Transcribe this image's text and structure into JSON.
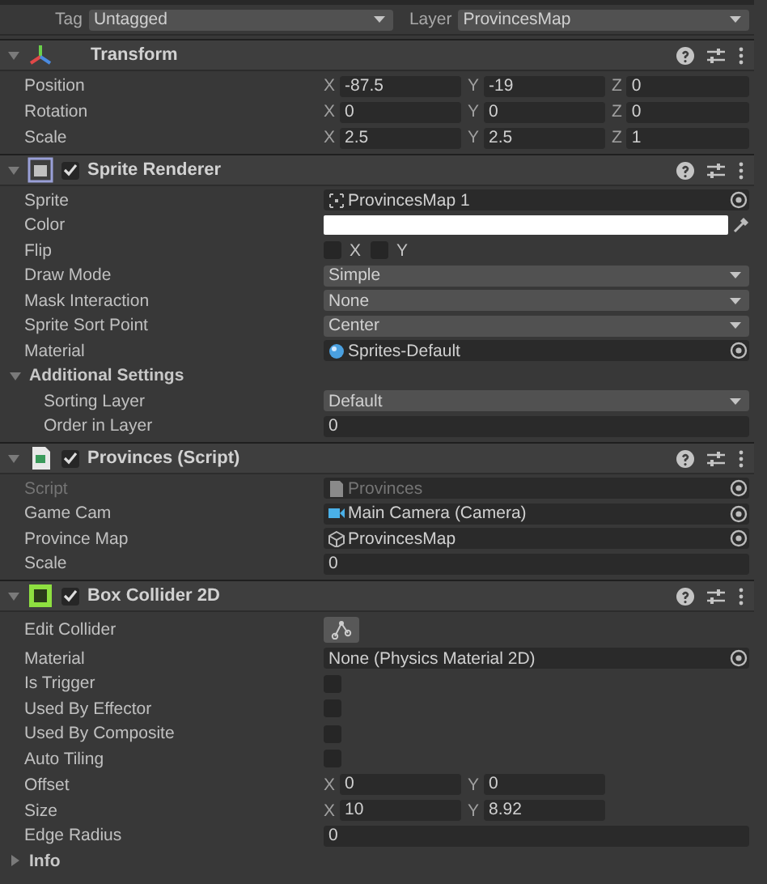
{
  "header": {
    "tag_label": "Tag",
    "tag": "Untagged",
    "layer_label": "Layer",
    "layer": "ProvincesMap"
  },
  "components": [
    {
      "name": "Transform",
      "kind": "transform",
      "expanded": true,
      "rows": [
        {
          "kind": "vector",
          "label": "Position",
          "axes": [
            {
              "axis": "X",
              "value": "-87.5"
            },
            {
              "axis": "Y",
              "value": "-19"
            },
            {
              "axis": "Z",
              "value": "0"
            }
          ]
        },
        {
          "kind": "vector",
          "label": "Rotation",
          "axes": [
            {
              "axis": "X",
              "value": "0"
            },
            {
              "axis": "Y",
              "value": "0"
            },
            {
              "axis": "Z",
              "value": "0"
            }
          ]
        },
        {
          "kind": "vector",
          "label": "Scale",
          "axes": [
            {
              "axis": "X",
              "value": "2.5"
            },
            {
              "axis": "Y",
              "value": "2.5"
            },
            {
              "axis": "Z",
              "value": "1"
            }
          ]
        }
      ]
    },
    {
      "name": "Sprite Renderer",
      "kind": "renderer",
      "enabled": true,
      "expanded": true,
      "rows": [
        {
          "kind": "sprite",
          "label": "Sprite",
          "value": "ProvincesMap 1",
          "disabled": false
        },
        {
          "kind": "color",
          "label": "Color",
          "color": "#ffffff"
        },
        {
          "kind": "flip",
          "label": "Flip",
          "toggles": [
            {
              "label": "X",
              "checked": false
            },
            {
              "label": "Y",
              "checked": false
            }
          ]
        },
        {
          "kind": "dropdown",
          "label": "Draw Mode",
          "value": "Simple"
        },
        {
          "kind": "dropdown",
          "label": "Mask Interaction",
          "value": "None"
        },
        {
          "kind": "dropdown",
          "label": "Sprite Sort Point",
          "value": "Center"
        },
        {
          "kind": "material",
          "label": "Material",
          "value": "Sprites-Default",
          "disabled": false
        },
        {
          "kind": "foldout",
          "label": "Additional Settings",
          "expanded": true,
          "children": [
            {
              "kind": "dropdown",
              "label": "Sorting Layer",
              "value": "Default"
            },
            {
              "kind": "field",
              "label": "Order in Layer",
              "value": "0"
            }
          ]
        }
      ]
    },
    {
      "name": "Provinces (Script)",
      "kind": "script",
      "enabled": true,
      "expanded": true,
      "rows": [
        {
          "kind": "script",
          "label": "Script",
          "value": "Provinces",
          "disabled": true
        },
        {
          "kind": "camera",
          "label": "Game Cam",
          "value": "Main Camera (Camera)",
          "disabled": false
        },
        {
          "kind": "prefab",
          "label": "Province Map",
          "value": "ProvincesMap",
          "disabled": false
        },
        {
          "kind": "field",
          "label": "Scale",
          "value": "0"
        }
      ]
    },
    {
      "name": "Box Collider 2D",
      "kind": "collider",
      "enabled": true,
      "expanded": true,
      "rows": [
        {
          "kind": "button",
          "label": "Edit Collider"
        },
        {
          "kind": "reference",
          "label": "Material",
          "value": "None (Physics Material 2D)",
          "disabled": false
        },
        {
          "kind": "checkbox",
          "label": "Is Trigger",
          "checked": false
        },
        {
          "kind": "checkbox",
          "label": "Used By Effector",
          "checked": false
        },
        {
          "kind": "checkbox",
          "label": "Used By Composite",
          "checked": false
        },
        {
          "kind": "checkbox",
          "label": "Auto Tiling",
          "checked": false
        },
        {
          "kind": "vector",
          "label": "Offset",
          "axes": [
            {
              "axis": "X",
              "value": "0"
            },
            {
              "axis": "Y",
              "value": "0"
            }
          ]
        },
        {
          "kind": "vector",
          "label": "Size",
          "axes": [
            {
              "axis": "X",
              "value": "10"
            },
            {
              "axis": "Y",
              "value": "8.92"
            }
          ]
        },
        {
          "kind": "field",
          "label": "Edge Radius",
          "value": "0"
        },
        {
          "kind": "foldout",
          "label": "Info",
          "expanded": false
        }
      ]
    }
  ]
}
